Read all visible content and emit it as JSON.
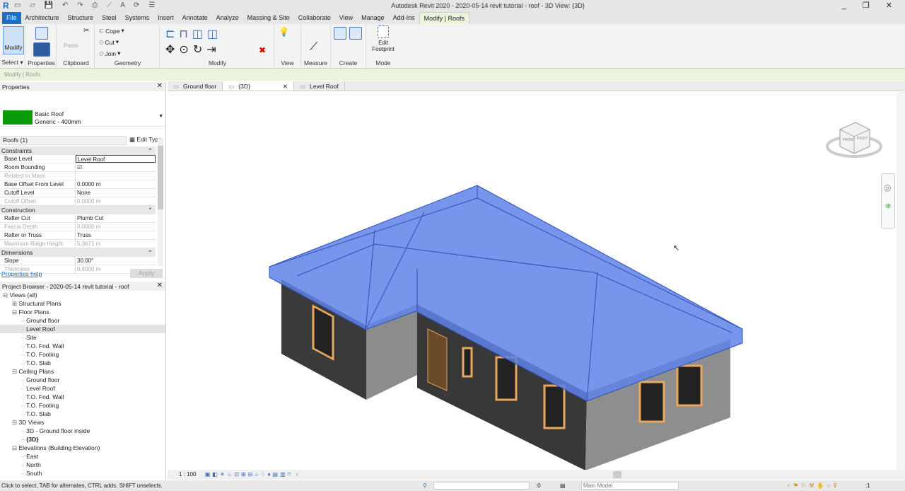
{
  "title": "Autodesk Revit 2020 - 2020-05-14 revit tutorial - roof - 3D View: {3D}",
  "tabs": [
    "File",
    "Architecture",
    "Structure",
    "Steel",
    "Systems",
    "Insert",
    "Annotate",
    "Analyze",
    "Massing & Site",
    "Collaborate",
    "View",
    "Manage",
    "Add-Ins",
    "Modify | Roofs"
  ],
  "ribbon": {
    "modify": "Modify",
    "select": "Select ▾",
    "properties": "Properties",
    "paste": "Paste",
    "clipboard": "Clipboard",
    "cope": "Cope",
    "cut": "Cut",
    "join": "Join",
    "geometry": "Geometry",
    "modify_panel": "Modify",
    "view": "View",
    "measure": "Measure",
    "create": "Create",
    "edit_footprint_1": "Edit",
    "edit_footprint_2": "Footprint",
    "mode": "Mode"
  },
  "context": "Modify | Roofs",
  "properties": {
    "title": "Properties",
    "type_name": "Basic Roof",
    "type_sub": "Generic - 400mm",
    "swatch": "#0a9a0a",
    "filter": "Roofs (1)",
    "edit_type": "Edit Type",
    "groups": [
      {
        "name": "Constraints",
        "rows": [
          {
            "k": "Base Level",
            "v": "Level Roof"
          },
          {
            "k": "Room Bounding",
            "v": "☑"
          },
          {
            "k": "Related to Mass",
            "v": "",
            "dis": true
          },
          {
            "k": "Base Offset From Level",
            "v": "0.0000 m"
          },
          {
            "k": "Cutoff Level",
            "v": "None"
          },
          {
            "k": "Cutoff Offset",
            "v": "0.0000 m",
            "dis": true
          }
        ]
      },
      {
        "name": "Construction",
        "rows": [
          {
            "k": "Rafter Cut",
            "v": "Plumb Cut"
          },
          {
            "k": "Fascia Depth",
            "v": "0.0000 m",
            "dis": true
          },
          {
            "k": "Rafter or Truss",
            "v": "Truss"
          },
          {
            "k": "Maximum Ridge Height",
            "v": "5.3671 m",
            "dis": true
          }
        ]
      },
      {
        "name": "Dimensions",
        "rows": [
          {
            "k": "Slope",
            "v": "30.00°"
          },
          {
            "k": "Thickness",
            "v": "0.4000 m",
            "dis": true
          }
        ]
      }
    ],
    "help": "Properties help",
    "apply": "Apply"
  },
  "browser": {
    "title": "Project Browser - 2020-05-14 revit tutorial - roof",
    "items": [
      {
        "t": "Views (all)",
        "l": 0,
        "e": "⊟"
      },
      {
        "t": "Structural Plans",
        "l": 1,
        "e": "⊞"
      },
      {
        "t": "Floor Plans",
        "l": 1,
        "e": "⊟"
      },
      {
        "t": "Ground floor",
        "l": 2
      },
      {
        "t": "Level Roof",
        "l": 2,
        "sel": true
      },
      {
        "t": "Site",
        "l": 2
      },
      {
        "t": "T.O. Fnd. Wall",
        "l": 2
      },
      {
        "t": "T.O. Footing",
        "l": 2
      },
      {
        "t": "T.O. Slab",
        "l": 2
      },
      {
        "t": "Ceiling Plans",
        "l": 1,
        "e": "⊟"
      },
      {
        "t": "Ground floor",
        "l": 2
      },
      {
        "t": "Level Roof",
        "l": 2
      },
      {
        "t": "T.O. Fnd. Wall",
        "l": 2
      },
      {
        "t": "T.O. Footing",
        "l": 2
      },
      {
        "t": "T.O. Slab",
        "l": 2
      },
      {
        "t": "3D Views",
        "l": 1,
        "e": "⊟"
      },
      {
        "t": "3D - Ground floor inside",
        "l": 2
      },
      {
        "t": "{3D}",
        "l": 2,
        "b": true
      },
      {
        "t": "Elevations (Building Elevation)",
        "l": 1,
        "e": "⊟"
      },
      {
        "t": "East",
        "l": 2
      },
      {
        "t": "North",
        "l": 2
      },
      {
        "t": "South",
        "l": 2
      }
    ]
  },
  "viewtabs": [
    {
      "t": "Ground floor"
    },
    {
      "t": "{3D}",
      "on": true
    },
    {
      "t": "Level Roof"
    }
  ],
  "viewcube": {
    "front": "FRONT",
    "right": "RIGHT"
  },
  "scale": "1 : 100",
  "status": {
    "hint": "Click to select, TAB for alternates, CTRL adds, SHIFT unselects.",
    "sel_count": ":0",
    "model": "Main Model",
    "filter_count": ":1"
  }
}
